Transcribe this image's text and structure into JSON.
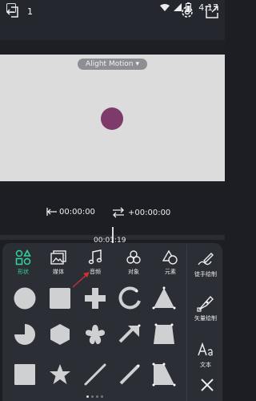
{
  "status_bar": {
    "time": "4:17"
  },
  "top_bar": {
    "project_number": "1"
  },
  "canvas": {
    "watermark": "Alight Motion",
    "watermark_caret": "▾",
    "circle_color": "#7d3a6a"
  },
  "transport": {
    "start_time": "00:00:00",
    "duration": "+00:00:00",
    "current_time": "00:01:19"
  },
  "tabs": [
    {
      "label": "形状",
      "icon": "shapes-icon",
      "active": true
    },
    {
      "label": "媒体",
      "icon": "media-icon",
      "active": false
    },
    {
      "label": "音频",
      "icon": "music-note-icon",
      "active": false
    },
    {
      "label": "对象",
      "icon": "object-icon",
      "active": false
    },
    {
      "label": "元素",
      "icon": "element-icon",
      "active": false
    }
  ],
  "side_tools": [
    {
      "label": "徒手绘制",
      "icon": "freehand-draw-icon"
    },
    {
      "label": "矢量绘制",
      "icon": "vector-draw-icon"
    },
    {
      "label": "文本",
      "icon": "text-icon"
    }
  ],
  "shapes": [
    "circle",
    "square",
    "plus",
    "arc",
    "triangle",
    "pie",
    "hexagon",
    "flower",
    "arrow",
    "trapezoid",
    "rounded-square",
    "star",
    "line",
    "pencil-line",
    "polygon"
  ],
  "colors": {
    "accent": "#34d49c",
    "shape_fill": "#cfd0d2",
    "panel": "#2c2e36"
  }
}
